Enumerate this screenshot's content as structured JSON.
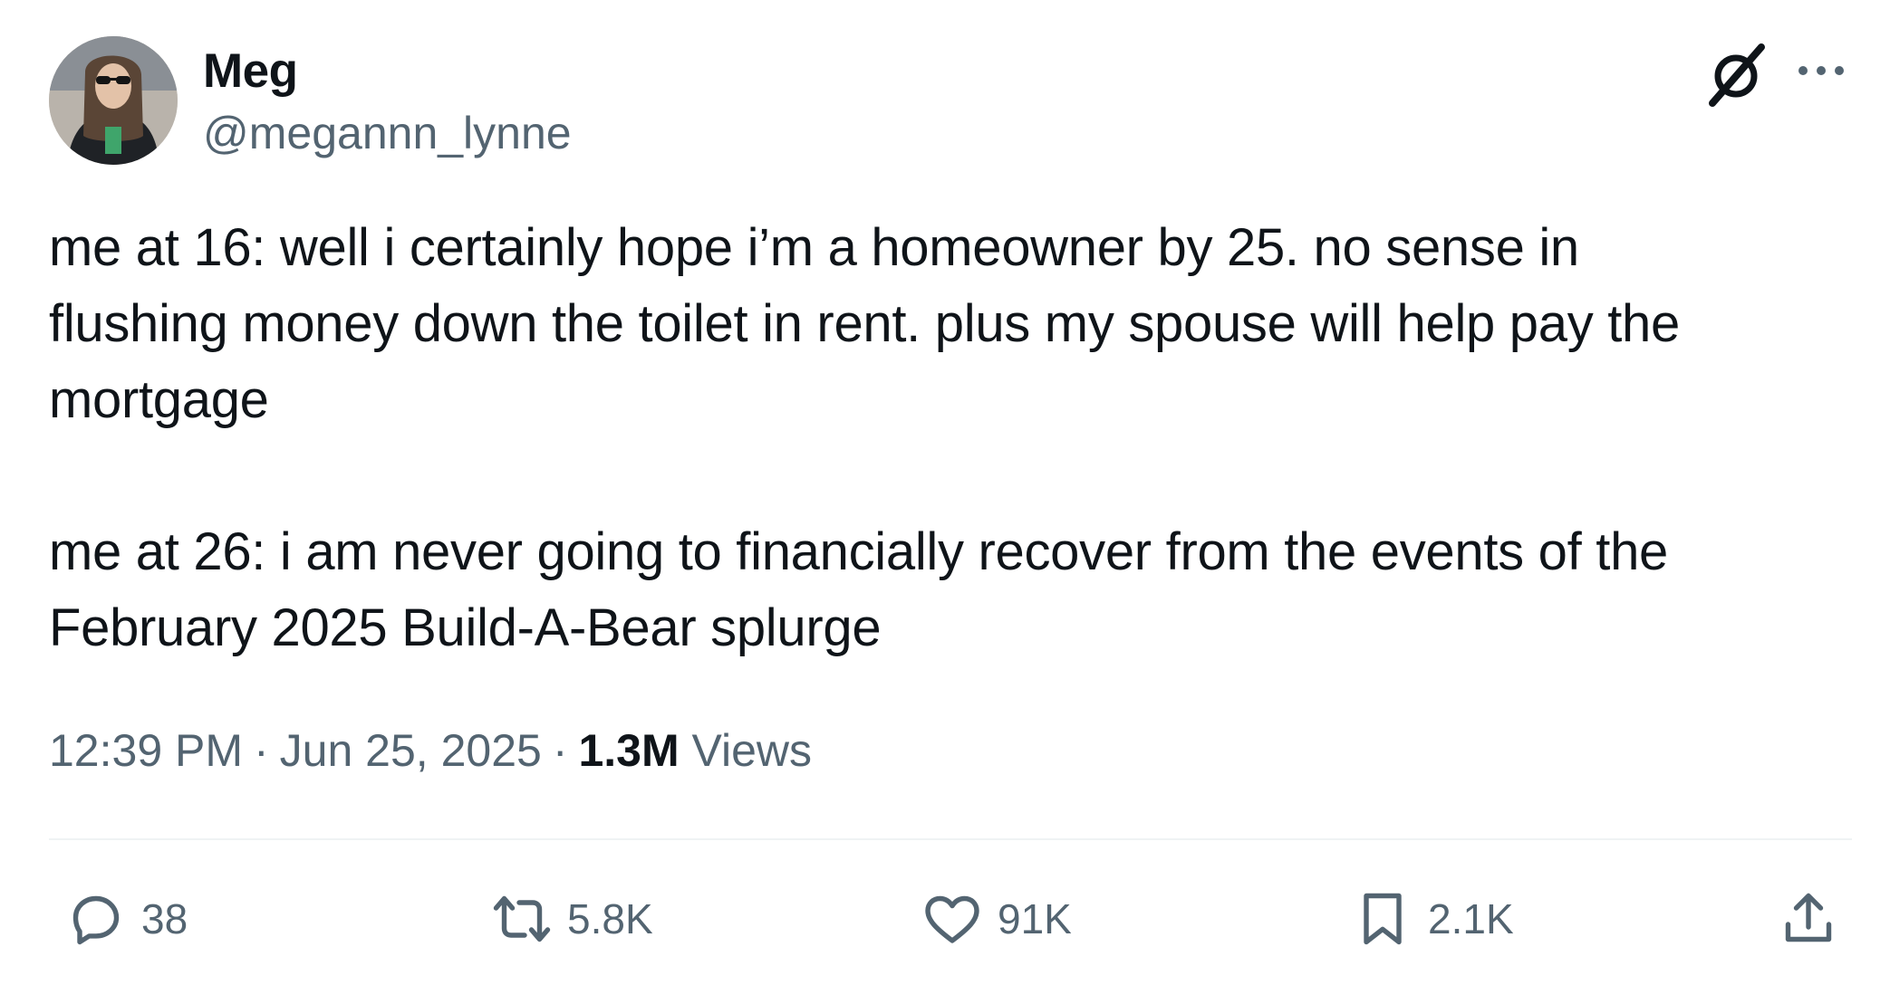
{
  "author": {
    "display_name": "Meg",
    "handle": "@megannn_lynne"
  },
  "tweet": {
    "paragraphs": [
      [
        "me at 16: well i certainly hope i’m a homeowner by 25. no sense in",
        "flushing money down the toilet in rent. plus my spouse will help pay the",
        "mortgage"
      ],
      [
        "me at 26: i am never going to financially recover from the events of the",
        "February 2025 Build-A-Bear splurge"
      ]
    ]
  },
  "meta": {
    "time": "12:39 PM",
    "separator": "·",
    "date": "Jun 25, 2025",
    "views_count": "1.3M",
    "views_label": "Views"
  },
  "actions": {
    "replies": "38",
    "reposts": "5.8K",
    "likes": "91K",
    "bookmarks": "2.1K"
  },
  "icons": {
    "header": [
      "grok-icon",
      "more-icon"
    ],
    "actions": [
      "reply-icon",
      "repost-icon",
      "like-icon",
      "bookmark-icon",
      "share-icon"
    ]
  },
  "colors": {
    "text_primary": "#0f1419",
    "text_secondary": "#536471",
    "divider": "#eff3f4"
  }
}
